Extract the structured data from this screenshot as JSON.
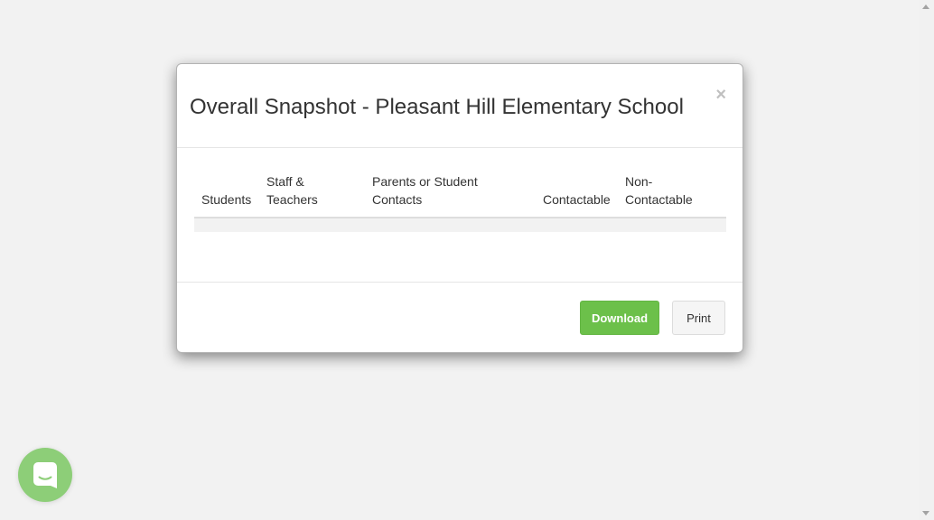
{
  "modal": {
    "title": "Overall Snapshot - Pleasant Hill Elementary School",
    "close_glyph": "×",
    "table": {
      "columns": [
        {
          "line1": "",
          "line2": "Students"
        },
        {
          "line1": "Staff &",
          "line2": "Teachers"
        },
        {
          "line1": "Parents or Student",
          "line2": "Contacts"
        },
        {
          "line1": "",
          "line2": "Contactable"
        },
        {
          "line1": "Non-",
          "line2": "Contactable"
        }
      ]
    },
    "footer": {
      "download_label": "Download",
      "print_label": "Print"
    }
  },
  "chat": {
    "icon": "chat-bubble-icon"
  },
  "colors": {
    "background": "#f2f2f2",
    "download_button": "#6cc04a",
    "chat_launcher": "#8dce78"
  }
}
